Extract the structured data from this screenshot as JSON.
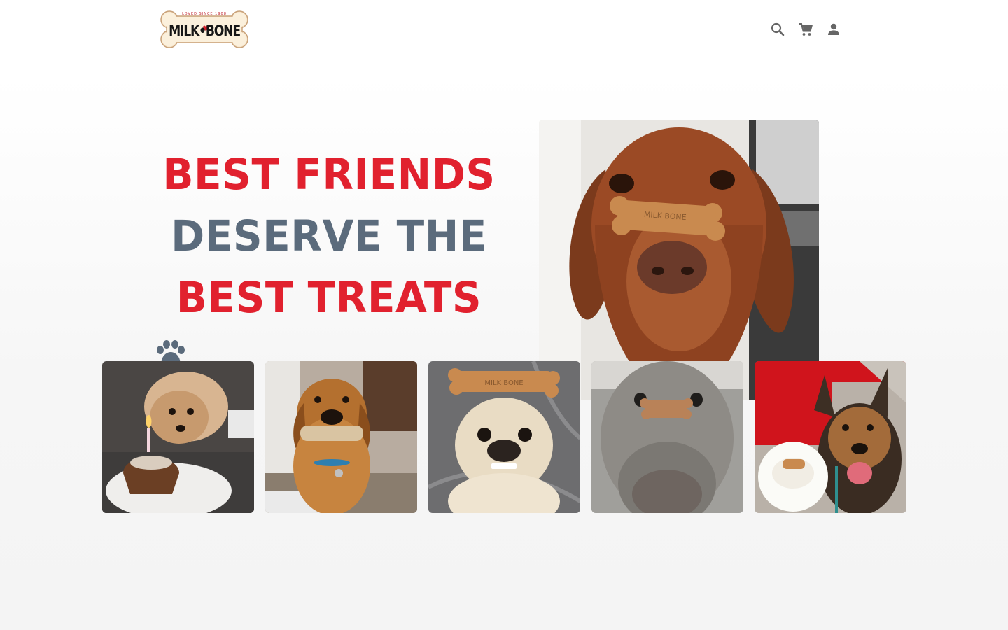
{
  "header": {
    "logo": {
      "brand": "MILK•BONE",
      "tagline": "LOVED SINCE 1908"
    },
    "icons": [
      "search-icon",
      "cart-icon",
      "account-icon"
    ]
  },
  "hero": {
    "headline": {
      "line1": "BEST FRIENDS",
      "line2": "DESERVE THE",
      "line3": "BEST TREATS"
    },
    "main_photo": "vizsla-dog-balancing-milk-bone-on-nose"
  },
  "gallery": {
    "paw_icon": "paw-icon",
    "thumbnails": [
      "pomeranian-with-birthday-cupcake",
      "beagle-mix-holding-bone-in-mouth",
      "chihuahua-with-bone-on-head",
      "weimaraner-with-bone-on-nose",
      "german-shepherd-with-bone-treat"
    ]
  },
  "colors": {
    "accent_red": "#e1212e",
    "slate": "#5b6b7c",
    "icon_gray": "#666666"
  }
}
